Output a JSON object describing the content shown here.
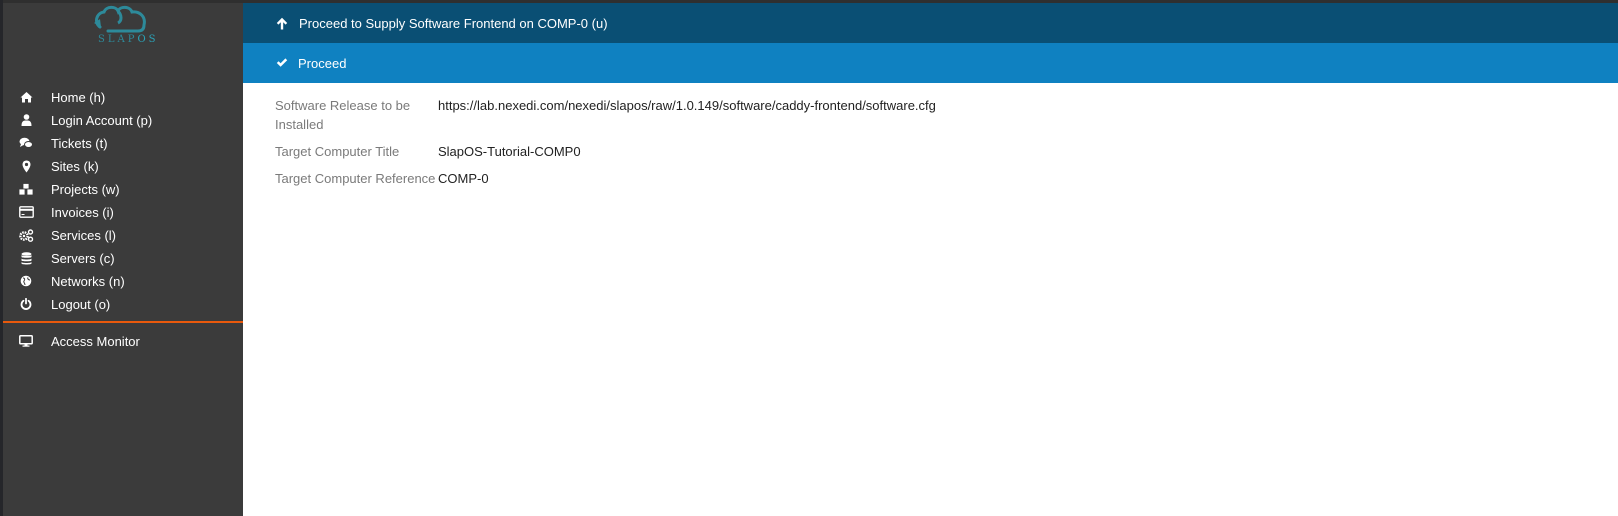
{
  "brand": {
    "logo_text_a": "SLAP",
    "logo_text_b": "OS",
    "color": "#2d8a9a"
  },
  "sidebar": {
    "items": [
      {
        "label": "Home (h)",
        "icon": "home-icon"
      },
      {
        "label": "Login Account (p)",
        "icon": "user-icon"
      },
      {
        "label": "Tickets (t)",
        "icon": "comments-icon"
      },
      {
        "label": "Sites (k)",
        "icon": "map-marker-icon"
      },
      {
        "label": "Projects (w)",
        "icon": "cubes-icon"
      },
      {
        "label": "Invoices (i)",
        "icon": "credit-card-icon"
      },
      {
        "label": "Services (l)",
        "icon": "cogs-icon"
      },
      {
        "label": "Servers (c)",
        "icon": "database-icon"
      },
      {
        "label": "Networks (n)",
        "icon": "globe-icon"
      },
      {
        "label": "Logout (o)",
        "icon": "power-icon"
      }
    ],
    "secondary": [
      {
        "label": "Access Monitor",
        "icon": "desktop-icon"
      }
    ],
    "separator_color": "#e8590c"
  },
  "header": {
    "title": "Proceed to Supply Software Frontend on COMP-0 (u)",
    "proceed_label": "Proceed",
    "colors": {
      "title_bar": "#0a4f74",
      "action_bar": "#0f81c1"
    }
  },
  "form": {
    "fields": [
      {
        "label": "Software Release to be Installed",
        "value": "https://lab.nexedi.com/nexedi/slapos/raw/1.0.149/software/caddy-frontend/software.cfg"
      },
      {
        "label": "Target Computer Title",
        "value": "SlapOS-Tutorial-COMP0"
      },
      {
        "label": "Target Computer Reference",
        "value": "COMP-0"
      }
    ]
  }
}
